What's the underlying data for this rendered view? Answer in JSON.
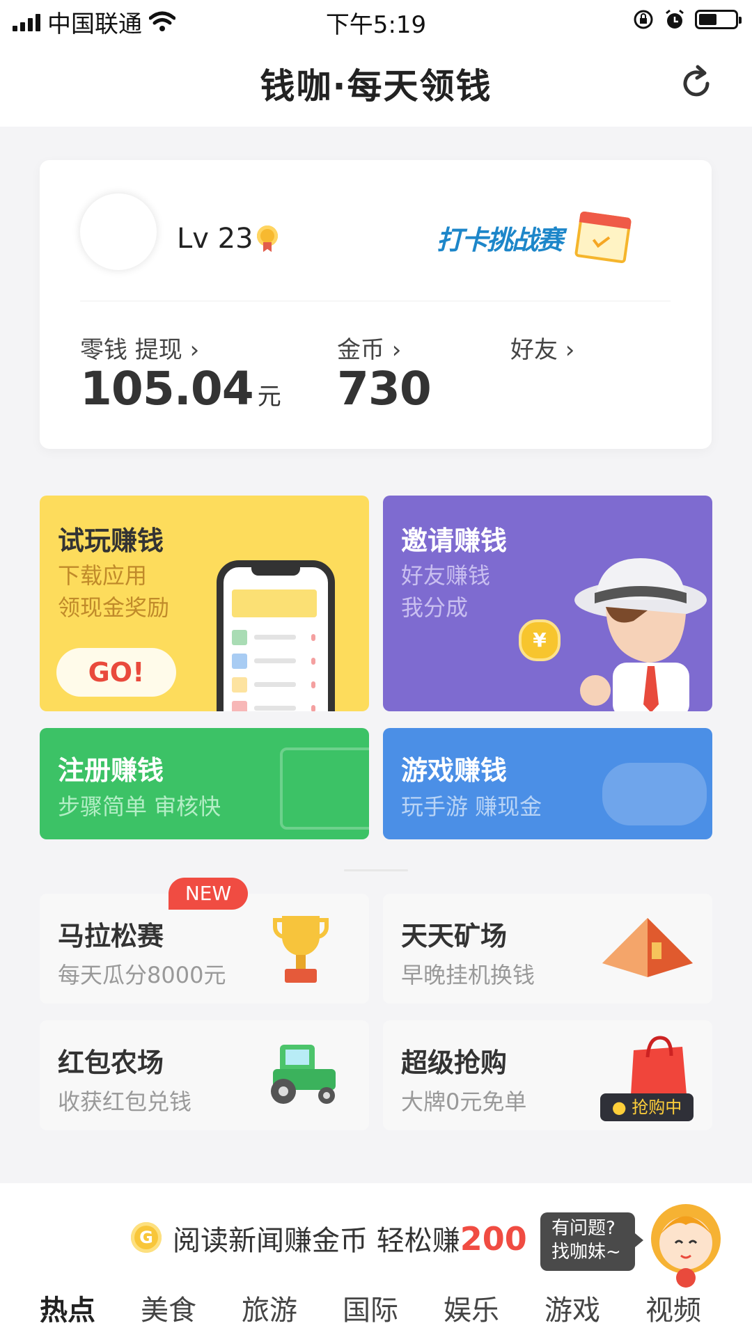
{
  "status_bar": {
    "carrier": "中国联通",
    "time": "下午5:19"
  },
  "nav": {
    "title": "钱咖·每天领钱"
  },
  "user_card": {
    "level": "Lv 23",
    "challenge_label": "打卡挑战赛",
    "stats": [
      {
        "label": "零钱  提现  ›",
        "value": "105.04",
        "unit": "元"
      },
      {
        "label": "金币  ›",
        "value": "730"
      },
      {
        "label": "好友  ›",
        "value": ""
      }
    ]
  },
  "features": {
    "trial": {
      "title": "试玩赚钱",
      "sub1": "下载应用",
      "sub2": "领现金奖励",
      "button": "GO!"
    },
    "invite": {
      "title": "邀请赚钱",
      "sub1": "好友赚钱",
      "sub2": "我分成",
      "coin": "¥"
    },
    "register": {
      "title": "注册赚钱",
      "sub": "步骤简单  审核快"
    },
    "game": {
      "title": "游戏赚钱",
      "sub": "玩手游  赚现金"
    }
  },
  "mini_tiles": [
    {
      "title": "马拉松赛",
      "sub": "每天瓜分8000元",
      "badge": "NEW"
    },
    {
      "title": "天天矿场",
      "sub": "早晚挂机换钱"
    },
    {
      "title": "红包农场",
      "sub": "收获红包兑钱"
    },
    {
      "title": "超级抢购",
      "sub": "大牌0元免单",
      "badge": "● 抢购中"
    }
  ],
  "news_banner": {
    "coin": "G",
    "text": "阅读新闻赚金币  轻松赚",
    "amount": "200"
  },
  "help": {
    "line1": "有问题?",
    "line2": "找咖妹~"
  },
  "categories": [
    "热点",
    "美食",
    "旅游",
    "国际",
    "娱乐",
    "游戏",
    "视频"
  ],
  "colors": {
    "yellow": "#fddc5c",
    "purple": "#7e6bd0",
    "green": "#3cc266",
    "blue": "#4b8fe6",
    "accent_red": "#f04c42"
  }
}
